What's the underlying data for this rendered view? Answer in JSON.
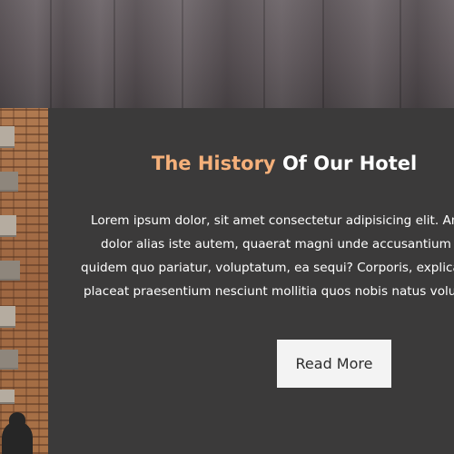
{
  "section": {
    "title_accent": "The History",
    "title_rest": "Of Our Hotel",
    "body_lines": [
      "Lorem ipsum dolor, sit amet consectetur adipisicing elit. Amet",
      "dolor alias iste autem, quaerat magni unde accusantium",
      "quidem quo pariatur, voluptatum, ea sequi? Corporis, explicabo",
      "placeat praesentium nesciunt mollitia quos nobis natus voluptas."
    ],
    "button_label": "Read More"
  },
  "colors": {
    "accent": "#f5b07a",
    "panel": "#3b3a3a",
    "button_bg": "#f3f3f3"
  }
}
